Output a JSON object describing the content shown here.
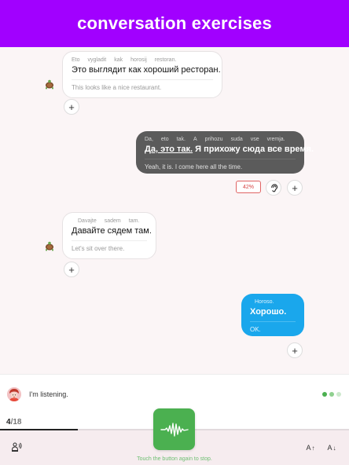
{
  "header": {
    "title": "conversation exercises",
    "color": "#a100ff"
  },
  "messages": [
    {
      "side": "left",
      "style": "white",
      "translit": [
        "Eto",
        "vygladit",
        "kak",
        "horosij",
        "restoran."
      ],
      "russian_parts": [
        {
          "text": "Это выглядит как хороший ресторан.",
          "underline": false
        }
      ],
      "english": "This looks like a nice restaurant."
    },
    {
      "side": "right",
      "style": "dark",
      "translit": [
        "Da,",
        "eto",
        "tak.",
        "A",
        "prihozu",
        "suda",
        "vse",
        "vremja."
      ],
      "russian_parts": [
        {
          "text": "Да, это так.",
          "underline": true
        },
        {
          "text": " Я прихожу сюда все время.",
          "underline": false
        }
      ],
      "english": "Yeah, it is. I come here all the time.",
      "score": "42%"
    },
    {
      "side": "left",
      "style": "white",
      "translit": [
        "Davajte",
        "sadem",
        "tam."
      ],
      "russian_parts": [
        {
          "text": "Давайте сядем там.",
          "underline": false
        }
      ],
      "english": "Let's sit over there."
    },
    {
      "side": "right",
      "style": "blue",
      "translit": [
        "Horoso."
      ],
      "russian_parts": [
        {
          "text": "Хорошо.",
          "underline": false
        }
      ],
      "english": "OK."
    }
  ],
  "status": {
    "listening_text": "I'm listening.",
    "dot_colors": [
      "#4bb050",
      "#8fd08f",
      "#cde9cd"
    ]
  },
  "progress": {
    "current": "4",
    "total": "/18",
    "fraction": 0.222
  },
  "footer": {
    "hint": "Touch the button again to stop.",
    "font_increase_label": "A",
    "font_decrease_label": "A",
    "icons": [
      "speaker-settings-icon",
      "waveform-icon",
      "font-increase-icon",
      "font-decrease-icon"
    ]
  },
  "colors": {
    "accent_green": "#4bb050",
    "bubble_blue": "#1aa7ec",
    "bubble_dark": "#5b5b5b",
    "score_red": "#d64545"
  }
}
